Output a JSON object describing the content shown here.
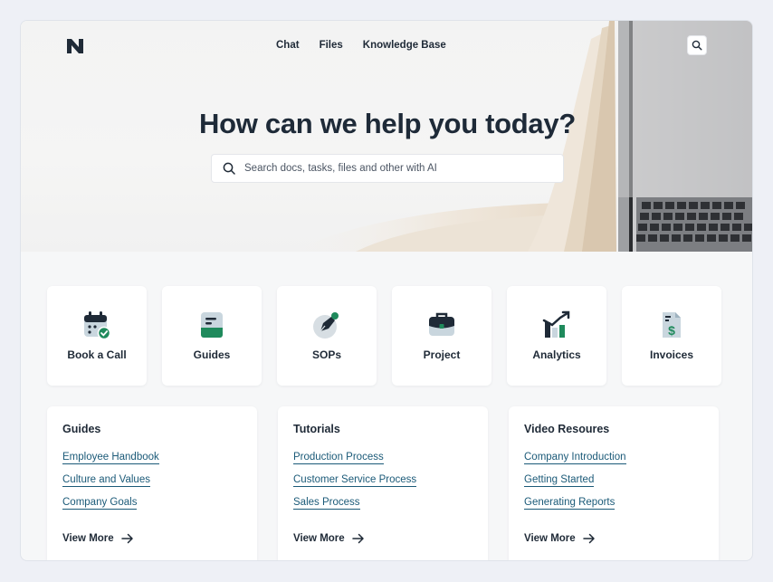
{
  "nav": {
    "links": [
      "Chat",
      "Files",
      "Knowledge Base"
    ]
  },
  "hero": {
    "title": "How can we help you today?",
    "search_placeholder": "Search docs, tasks, files and other with AI"
  },
  "categories": [
    {
      "label": "Book a Call",
      "icon": "calendar-check-icon"
    },
    {
      "label": "Guides",
      "icon": "book-icon"
    },
    {
      "label": "SOPs",
      "icon": "pen-nib-icon"
    },
    {
      "label": "Project",
      "icon": "briefcase-icon"
    },
    {
      "label": "Analytics",
      "icon": "bar-chart-trend-icon"
    },
    {
      "label": "Invoices",
      "icon": "invoice-dollar-icon"
    }
  ],
  "panels": [
    {
      "title": "Guides",
      "links": [
        "Employee Handbook",
        "Culture and Values",
        "Company Goals"
      ],
      "view_more": "View More"
    },
    {
      "title": "Tutorials",
      "links": [
        "Production Process",
        "Customer Service Process",
        "Sales Process"
      ],
      "view_more": "View More"
    },
    {
      "title": "Video Resoures",
      "links": [
        "Company Introduction",
        "Getting Started",
        "Generating Reports"
      ],
      "view_more": "View More"
    }
  ],
  "colors": {
    "accent_green": "#1f8a5c",
    "link_color": "#1b5a78",
    "text_dark": "#1f2a37"
  }
}
